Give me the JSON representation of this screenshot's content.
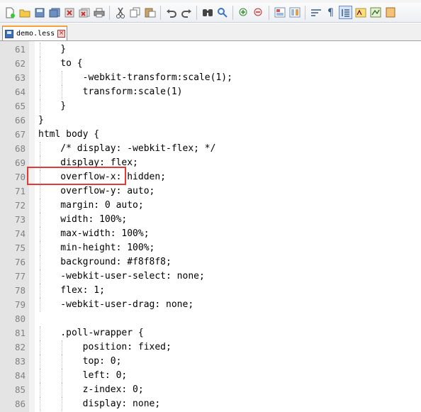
{
  "toolbar": {
    "icons": [
      "new-file-icon",
      "open-folder-icon",
      "save-icon",
      "save-all-icon",
      "close-icon",
      "close-all-icon",
      "print-icon",
      "cut-icon",
      "copy-icon",
      "paste-icon",
      "undo-icon",
      "redo-icon",
      "find-icon",
      "replace-icon",
      "zoom-in-icon",
      "zoom-out-icon",
      "sync-vertical-icon",
      "sync-horizontal-icon",
      "word-wrap-icon",
      "show-all-chars-icon",
      "indent-guide-icon",
      "user-lang-icon",
      "doc-map-icon",
      "function-list-icon"
    ]
  },
  "tab": {
    "label": "demo.less",
    "close_glyph": "×"
  },
  "editor": {
    "lines": [
      {
        "num": "61",
        "text": "    }"
      },
      {
        "num": "62",
        "text": "    to {"
      },
      {
        "num": "63",
        "text": "        -webkit-transform:scale(1);"
      },
      {
        "num": "64",
        "text": "        transform:scale(1)"
      },
      {
        "num": "65",
        "text": "    }"
      },
      {
        "num": "66",
        "text": "}"
      },
      {
        "num": "67",
        "text": "html body {"
      },
      {
        "num": "68",
        "text": "    /* display: -webkit-flex; */"
      },
      {
        "num": "69",
        "text": "    display: flex;"
      },
      {
        "num": "70",
        "text": "    overflow-x: hidden;"
      },
      {
        "num": "71",
        "text": "    overflow-y: auto;"
      },
      {
        "num": "72",
        "text": "    margin: 0 auto;"
      },
      {
        "num": "73",
        "text": "    width: 100%;"
      },
      {
        "num": "74",
        "text": "    max-width: 100%;"
      },
      {
        "num": "75",
        "text": "    min-height: 100%;"
      },
      {
        "num": "76",
        "text": "    background: #f8f8f8;"
      },
      {
        "num": "77",
        "text": "    -webkit-user-select: none;"
      },
      {
        "num": "78",
        "text": "    flex: 1;"
      },
      {
        "num": "79",
        "text": "    -webkit-user-drag: none;"
      },
      {
        "num": "80",
        "text": ""
      },
      {
        "num": "81",
        "text": "    .poll-wrapper {"
      },
      {
        "num": "82",
        "text": "        position: fixed;"
      },
      {
        "num": "83",
        "text": "        top: 0;"
      },
      {
        "num": "84",
        "text": "        left: 0;"
      },
      {
        "num": "85",
        "text": "        z-index: 0;"
      },
      {
        "num": "86",
        "text": "        display: none;"
      }
    ]
  },
  "colors": {
    "highlight_border": "#e53935",
    "tab_accent": "#f4a23c",
    "line_number": "#808080"
  }
}
